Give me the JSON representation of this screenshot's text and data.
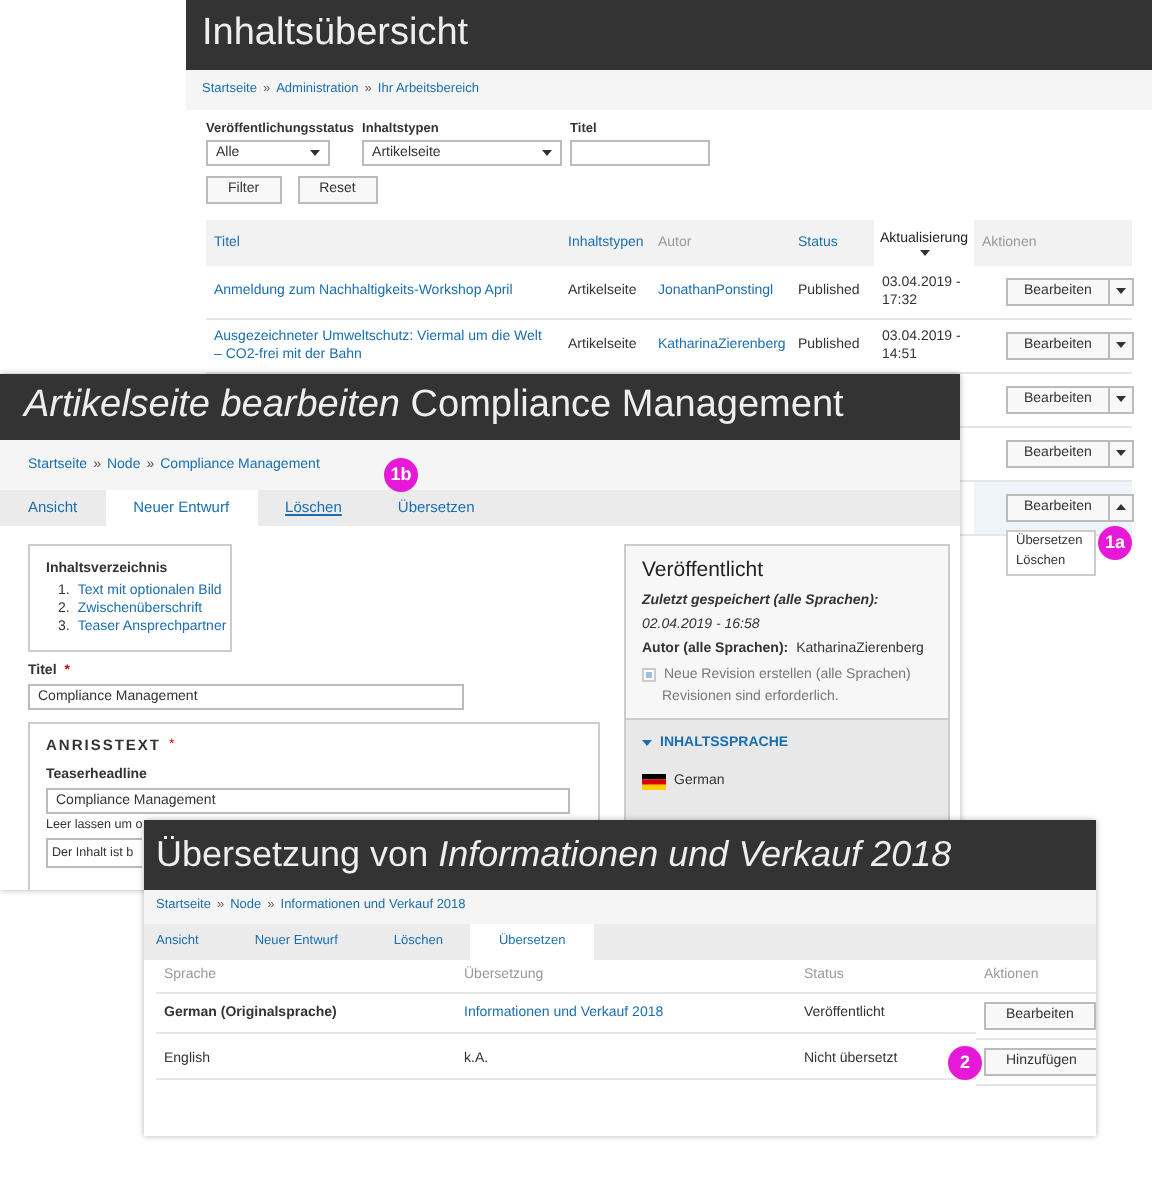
{
  "overview": {
    "title": "Inhaltsübersicht",
    "separator": "»",
    "breadcrumb": [
      "Startseite",
      "Administration",
      "Ihr Arbeitsbereich"
    ],
    "filters": [
      {
        "label": "Veröffentlichungsstatus",
        "kind": "select",
        "value": "Alle"
      },
      {
        "label": "Inhaltstypen",
        "kind": "select",
        "value": "Artikelseite"
      },
      {
        "label": "Titel",
        "kind": "text"
      }
    ],
    "buttons": [
      "Filter",
      "Reset"
    ],
    "columns": [
      {
        "label": "Titel",
        "sortable": true,
        "sorted": false
      },
      {
        "label": "Inhaltstypen",
        "sortable": true,
        "sorted": false
      },
      {
        "label": "Autor",
        "sortable": false,
        "sorted": false
      },
      {
        "label": "Status",
        "sortable": true,
        "sorted": false
      },
      {
        "label": "Aktualisierung",
        "sortable": true,
        "sorted": true
      },
      {
        "label": "Aktionen",
        "sortable": false,
        "sorted": false
      }
    ],
    "rows": [
      {
        "kind": "full",
        "title": "Anmeldung zum Nachhaltigkeits-Workshop April",
        "type": "Artikelseite",
        "author": "JonathanPonstingl",
        "status": "Published",
        "updated": "03.04.2019 - 17:32",
        "action": "Bearbeiten",
        "highlighted": false,
        "expanded": false
      },
      {
        "kind": "full",
        "title": "Ausgezeichneter Umweltschutz: Viermal um die Welt – CO2-frei mit der Bahn",
        "type": "Artikelseite",
        "author": "KatharinaZierenberg",
        "status": "Published",
        "updated": "03.04.2019 - 14:51",
        "action": "Bearbeiten",
        "highlighted": false,
        "expanded": false
      },
      {
        "kind": "covered",
        "action": "Bearbeiten",
        "highlighted": false,
        "expanded": false
      },
      {
        "kind": "covered",
        "action": "Bearbeiten",
        "highlighted": false,
        "expanded": false
      },
      {
        "kind": "covered",
        "action": "Bearbeiten",
        "highlighted": true,
        "expanded": true,
        "menu": [
          "Übersetzen",
          "Löschen"
        ]
      }
    ],
    "badge": "1a"
  },
  "editor": {
    "title": "*Artikelseite bearbeiten* Compliance Management",
    "separator": "»",
    "breadcrumb": [
      "Startseite",
      "Node",
      "Compliance Management"
    ],
    "tabs": [
      {
        "label": "Ansicht",
        "selected": false,
        "hovered": false
      },
      {
        "label": "Neuer Entwurf",
        "selected": true,
        "hovered": false
      },
      {
        "label": "Löschen",
        "selected": false,
        "hovered": true
      },
      {
        "label": "Übersetzen",
        "selected": false,
        "hovered": false
      }
    ],
    "badge": "1b",
    "toc": {
      "heading": "Inhaltsverzeichnis",
      "items": [
        {
          "number": "1.",
          "label": "Text mit optionalen Bild"
        },
        {
          "number": "2.",
          "label": "Zwischenüberschrift"
        },
        {
          "number": "3.",
          "label": "Teaser Ansprechpartner"
        }
      ]
    },
    "title_field": {
      "label": "Titel",
      "marker": "*",
      "value": "Compliance Management"
    },
    "teaser": {
      "legend": "ANRISSTEXT",
      "marker": "*",
      "label": "Teaserheadline",
      "value": "Compliance Management",
      "hint": "Leer lassen um o",
      "body": "Der Inhalt ist b"
    },
    "sidebar": {
      "heading": "Veröffentlicht",
      "saved_label": "Zuletzt gespeichert (alle Sprachen):",
      "saved_value": "02.04.2019 - 16:58",
      "author_label": "Autor (alle Sprachen):",
      "author": "KatharinaZierenberg",
      "revision": {
        "label": "Neue Revision erstellen (alle Sprachen)",
        "checked": true,
        "disabled": true,
        "note": "Revisionen sind erforderlich."
      },
      "language": {
        "title": "INHALTSSPRACHE",
        "expanded": true,
        "value": "German"
      }
    }
  },
  "translation": {
    "title": "Übersetzung von *Informationen und Verkauf 2018*",
    "separator": "»",
    "breadcrumb": [
      "Startseite",
      "Node",
      "Informationen und Verkauf 2018"
    ],
    "tabs": [
      {
        "label": "Ansicht",
        "selected": false
      },
      {
        "label": "Neuer Entwurf",
        "selected": false
      },
      {
        "label": "Löschen",
        "selected": false
      },
      {
        "label": "Übersetzen",
        "selected": true
      }
    ],
    "columns": [
      "Sprache",
      "Übersetzung",
      "Status",
      "Aktionen"
    ],
    "rows": [
      {
        "language": "German (Originalsprache)",
        "is_original": true,
        "translation": "Informationen und Verkauf 2018",
        "linked": true,
        "status": "Veröffentlicht",
        "action": "Bearbeiten"
      },
      {
        "language": "English",
        "is_original": false,
        "translation": "k.A.",
        "linked": false,
        "status": "Nicht übersetzt",
        "action": "Hinzufügen",
        "badge": "2"
      }
    ]
  }
}
